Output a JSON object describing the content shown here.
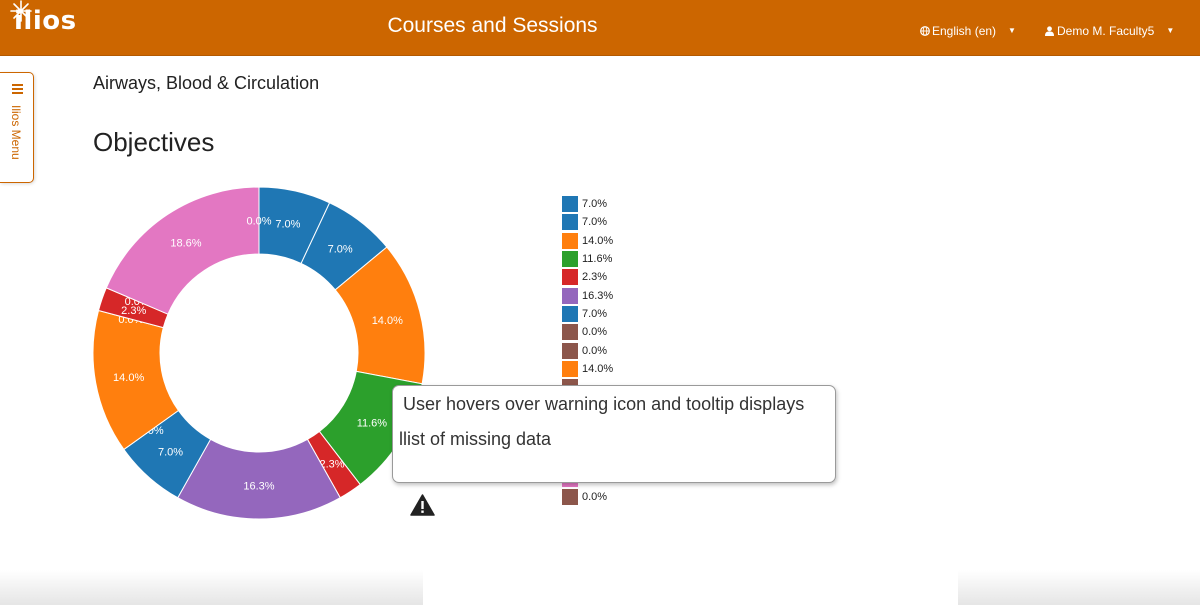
{
  "header": {
    "logo_text": "ilios",
    "title": "Courses and Sessions",
    "language_label": "English (en)",
    "user_label": "Demo M. Faculty5",
    "brand_color": "#cc6600"
  },
  "sidebar": {
    "menu_label": "Ilios Menu"
  },
  "course": {
    "title": "Airways, Blood & Circulation"
  },
  "section": {
    "title": "Objectives"
  },
  "chart_data": {
    "type": "pie",
    "donut": true,
    "slices": [
      {
        "label": "7.0%",
        "value": 7.0,
        "color": "#1f77b4"
      },
      {
        "label": "7.0%",
        "value": 7.0,
        "color": "#1f77b4"
      },
      {
        "label": "14.0%",
        "value": 14.0,
        "color": "#ff7f0e"
      },
      {
        "label": "11.6%",
        "value": 11.6,
        "color": "#2ca02c"
      },
      {
        "label": "2.3%",
        "value": 2.3,
        "color": "#d62728"
      },
      {
        "label": "16.3%",
        "value": 16.3,
        "color": "#9467bd"
      },
      {
        "label": "7.0%",
        "value": 7.0,
        "color": "#1f77b4"
      },
      {
        "label": "0.0%",
        "value": 0.0,
        "color": "#8c564b"
      },
      {
        "label": "14.0%",
        "value": 14.0,
        "color": "#ff7f0e"
      },
      {
        "label": "0.0%",
        "value": 0.0,
        "color": "#8c564b"
      },
      {
        "label": "2.3%",
        "value": 2.3,
        "color": "#d62728"
      },
      {
        "label": "0.0%",
        "value": 0.0,
        "color": "#8c564b"
      },
      {
        "label": "18.6%",
        "value": 18.6,
        "color": "#e377c2"
      },
      {
        "label": "0.0%",
        "value": 0.0,
        "color": "#8c564b"
      }
    ],
    "legend": [
      {
        "label": "7.0%",
        "color": "#1f77b4"
      },
      {
        "label": "7.0%",
        "color": "#1f77b4"
      },
      {
        "label": "14.0%",
        "color": "#ff7f0e"
      },
      {
        "label": "11.6%",
        "color": "#2ca02c"
      },
      {
        "label": "2.3%",
        "color": "#d62728"
      },
      {
        "label": "16.3%",
        "color": "#9467bd"
      },
      {
        "label": "7.0%",
        "color": "#1f77b4"
      },
      {
        "label": "0.0%",
        "color": "#8c564b"
      },
      {
        "label": "0.0%",
        "color": "#8c564b"
      },
      {
        "label": "14.0%",
        "color": "#ff7f0e"
      },
      {
        "label": "",
        "color": "#8c564b"
      },
      {
        "label": "",
        "color": "#8c564b"
      },
      {
        "label": "",
        "color": "#8c564b"
      },
      {
        "label": "",
        "color": "#8c564b"
      },
      {
        "label": "",
        "color": "#8c564b"
      },
      {
        "label": "18.6%",
        "color": "#e377c2"
      },
      {
        "label": "0.0%",
        "color": "#8c564b"
      }
    ]
  },
  "callout": {
    "line1": "User hovers over warning icon and tooltip displays",
    "line2": "llist of missing data"
  },
  "warning": {
    "icon": "warning-icon"
  }
}
